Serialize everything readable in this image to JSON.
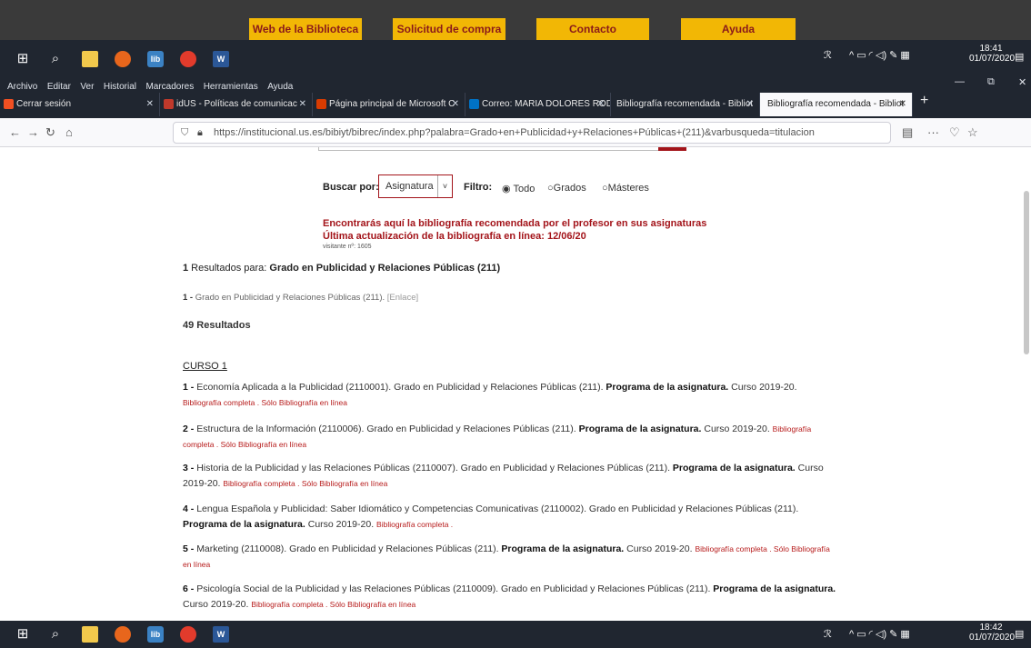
{
  "lib_nav": [
    "Web de la Biblioteca",
    "Solicitud de compra",
    "Contacto",
    "Ayuda"
  ],
  "taskbar": {
    "time_top": "18:41",
    "date_top": "01/07/2020",
    "time_bottom": "18:42",
    "date_bottom": "01/07/2020"
  },
  "menu": [
    "Archivo",
    "Editar",
    "Ver",
    "Historial",
    "Marcadores",
    "Herramientas",
    "Ayuda"
  ],
  "tabs": [
    {
      "label": "Cerrar sesión",
      "color": "#f25022"
    },
    {
      "label": "idUS - Políticas de comunicac",
      "color": "#c0392b"
    },
    {
      "label": "Página principal de Microsoft C",
      "color": "#d83b01"
    },
    {
      "label": "Correo: MARIA DOLORES ROD",
      "color": "#0072c6"
    },
    {
      "label": "Bibliografía recomendada - Bibliot",
      "color": "#555"
    },
    {
      "label": "Bibliografía recomendada - Bibliot",
      "color": "#555"
    }
  ],
  "url": "https://institucional.us.es/bibiyt/bibrec/index.php?palabra=Grado+en+Publicidad+y+Relaciones+Públicas+(211)&varbusqueda=titulacion",
  "search": {
    "buscar_label": "Buscar por:",
    "select_value": "Asignatura",
    "filtro_label": "Filtro:",
    "options": [
      "Todo",
      "Grados",
      "Másteres"
    ]
  },
  "notice": {
    "line1": "Encontrarás aquí la bibliografía recomendada por el profesor en sus asignaturas",
    "line2": "Última actualización de la bibliografía en línea: 12/06/20",
    "visitante": "visitante nº: 1605"
  },
  "results_header": {
    "count": "1",
    "text": " Resultados para: ",
    "bold": "Grado en Publicidad y Relaciones Públicas (211)"
  },
  "first_result": {
    "num": "1 -",
    "text": "Grado en Publicidad y Relaciones Públicas (211).",
    "link": "[Enlace]"
  },
  "total": "49 Resultados",
  "curso": "CURSO 1",
  "courses": [
    {
      "num": "1 -",
      "name": "Economía Aplicada a la Publicidad (2110001). Grado en Publicidad y Relaciones Públicas (211).",
      "prog": "Programa de la asignatura.",
      "year": "Curso 2019-20.",
      "links": "Bibliografía completa . Sólo Bibliografía en línea"
    },
    {
      "num": "2 -",
      "name": "Estructura de la Información (2110006). Grado en Publicidad y Relaciones Públicas (211).",
      "prog": "Programa de la asignatura.",
      "year": "Curso 2019-20.",
      "links": "Bibliografía completa . Sólo Bibliografía en línea"
    },
    {
      "num": "3 -",
      "name": "Historia de la Publicidad y las Relaciones Públicas (2110007). Grado en Publicidad y Relaciones Públicas (211).",
      "prog": "Programa de la asignatura.",
      "year": "Curso 2019-20.",
      "links": "Bibliografía completa . Sólo Bibliografía en línea"
    },
    {
      "num": "4 -",
      "name": "Lengua Española y Publicidad: Saber Idiomático y Competencias Comunicativas (2110002). Grado en Publicidad y Relaciones Públicas (211).",
      "prog": "Programa de la asignatura.",
      "year": "Curso 2019-20.",
      "links": "Bibliografía completa ."
    },
    {
      "num": "5 -",
      "name": "Marketing (2110008). Grado en Publicidad y Relaciones Públicas (211).",
      "prog": "Programa de la asignatura.",
      "year": "Curso 2019-20.",
      "links": "Bibliografía completa . Sólo Bibliografía en línea"
    },
    {
      "num": "6 -",
      "name": "Psicología Social de la Publicidad y las Relaciones Públicas (2110009). Grado en Publicidad y Relaciones Públicas (211).",
      "prog": "Programa de la asignatura.",
      "year": "Curso 2019-20.",
      "links": "Bibliografía completa . Sólo Bibliografía en línea"
    }
  ]
}
